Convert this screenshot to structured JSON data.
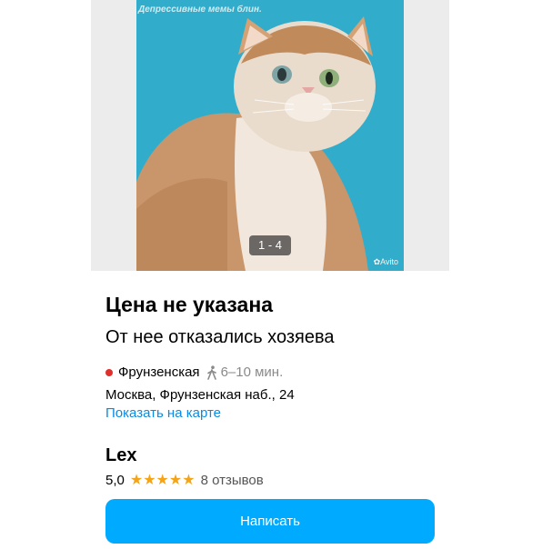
{
  "gallery": {
    "watermark": "Депрессивные мемы блин.",
    "counter": "1 - 4",
    "brand_mark": "Avito"
  },
  "listing": {
    "price": "Цена не указана",
    "title": "От нее отказались хозяева"
  },
  "location": {
    "metro_station": "Фрунзенская",
    "metro_color": "#e0302c",
    "walk_time": "6–10 мин.",
    "address": "Москва, Фрунзенская наб., 24",
    "map_link": "Показать на карте"
  },
  "seller": {
    "name": "Lex",
    "rating": "5,0",
    "stars": "★★★★★",
    "star_count": 5,
    "reviews": "8 отзывов"
  },
  "actions": {
    "write_label": "Написать",
    "accent": "#00aaff"
  }
}
